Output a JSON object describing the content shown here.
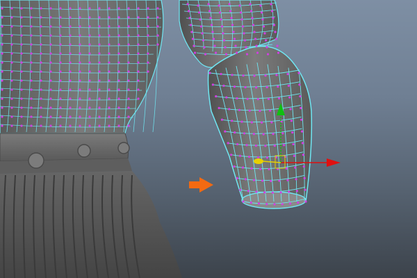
{
  "viewport": {
    "background_top": "#7e8fa4",
    "background_bottom": "#3c434b",
    "mesh_fill": "#6a6a6a",
    "edge_color_cyan": "#6fe6f2",
    "vertex_color_magenta": "#d040e0"
  },
  "manipulator": {
    "tool": "move-tool",
    "x_axis_color": "#e01010",
    "y_axis_color": "#10c010",
    "z_axis_color": "#e8d000"
  },
  "annotation": {
    "icon": "orange-arrow-icon",
    "color": "#f26a12"
  }
}
